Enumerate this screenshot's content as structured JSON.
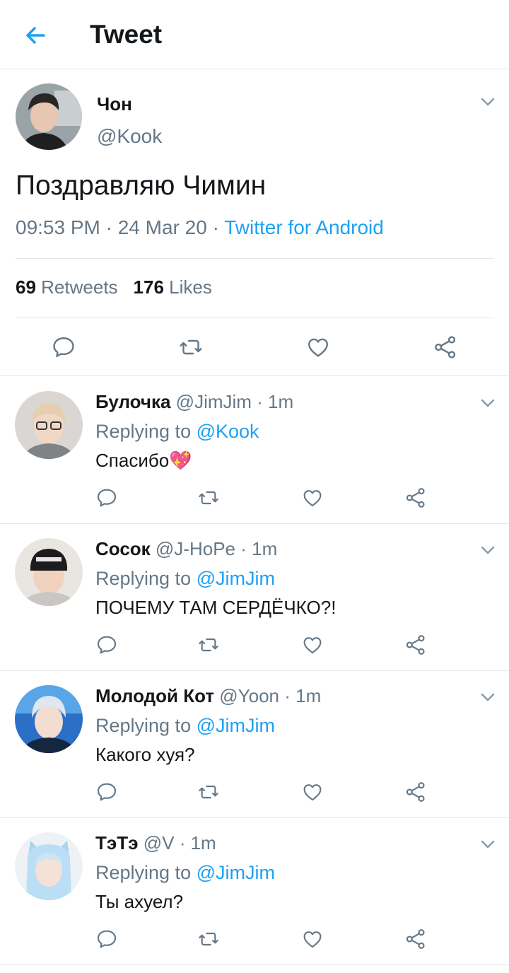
{
  "header": {
    "title": "Tweet",
    "back_icon": "arrow-left-icon"
  },
  "colors": {
    "accent": "#1da1f2",
    "muted": "#657786",
    "text": "#14171a",
    "divider": "#e1e8ed"
  },
  "main_tweet": {
    "name": "Чон",
    "handle": "@Kook",
    "text": "Поздравляю Чимин",
    "time": "09:53 PM · 24 Mar 20 · ",
    "source": "Twitter for Android",
    "retweets_count": "69",
    "retweets_label": "Retweets",
    "likes_count": "176",
    "likes_label": "Likes"
  },
  "replies": [
    {
      "name": "Булочка",
      "handle": "@JimJim",
      "time": "· 1m",
      "replying_label": "Replying to ",
      "replying_to": "@Kook",
      "text": "Спасибо",
      "emoji": "💖"
    },
    {
      "name": "Сосок",
      "handle": "@J-HoPe",
      "time": "· 1m",
      "replying_label": "Replying to ",
      "replying_to": "@JimJim",
      "text": "ПОЧЕМУ ТАМ СЕРДЁЧКО?!",
      "emoji": ""
    },
    {
      "name": "Молодой Кот",
      "handle": "@Yoon",
      "time": "· 1m",
      "replying_label": "Replying to ",
      "replying_to": "@JimJim",
      "text": "Какого хуя?",
      "emoji": ""
    },
    {
      "name": "ТэТэ",
      "handle": "@V",
      "time": "· 1m",
      "replying_label": "Replying to ",
      "replying_to": "@JimJim",
      "text": "Ты ахуел?",
      "emoji": ""
    }
  ]
}
